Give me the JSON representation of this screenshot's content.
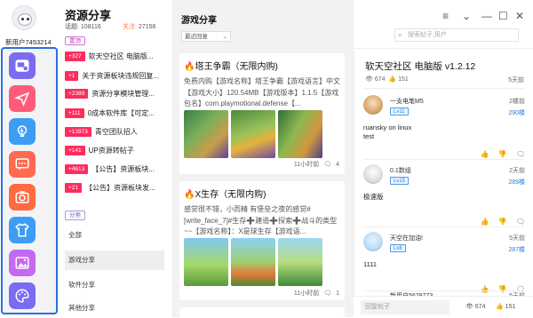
{
  "user": {
    "name": "新用户7453214"
  },
  "sidebar": {
    "colors": [
      "#7a6cf0",
      "#ff5c7a",
      "#3d9df5",
      "#ff6a50",
      "#ff6a40",
      "#3d9df5",
      "#c46af0",
      "#7a6cf0"
    ],
    "icons": [
      "community-icon",
      "send-icon",
      "bulb-icon",
      "chat-icon",
      "camera-icon",
      "shirt-icon",
      "image-icon",
      "palette-icon"
    ]
  },
  "forum": {
    "title": "资源分享",
    "posts_label": "话题:",
    "posts": "108116",
    "follow_label": "关注:",
    "follows": "27156",
    "hot_label": "置顶",
    "hot": [
      {
        "count": "+327",
        "title": "软天空社区 电脑版..."
      },
      {
        "count": "+1",
        "title": "关于资源板块违规回复..."
      },
      {
        "count": "+2389",
        "title": "资源分享模块管理..."
      },
      {
        "count": "+111",
        "title": "0成本软件库【可定..."
      },
      {
        "count": "+13973",
        "title": "青空团队招人"
      },
      {
        "count": "+141",
        "title": "UP资源转帖子"
      },
      {
        "count": "+4613",
        "title": "【公告】资源板块..."
      },
      {
        "count": "+21",
        "title": "【公告】资源板块发..."
      }
    ],
    "cat_label": "分类",
    "categories": [
      "全部",
      "游戏分享",
      "软件分享",
      "其他分享"
    ]
  },
  "feed": {
    "title": "游戏分享",
    "sort": "最近回复",
    "cards": [
      {
        "title": "塔王争霸（无限内购)",
        "desc": "免费内购【游戏名称】塔王争霸【游戏语言】中文【游戏大小】120.54MB【游戏版本】1.1.5【游戏包名】com.playmotional.defense【...",
        "time": "11小时前",
        "comments": "4"
      },
      {
        "title": "X生存（无限内购)",
        "desc": "感觉很不错，小而精 有堡垒之夜的感觉#[write_face_7]#生存➕建造➕探索➕战斗的类型~~【游戏名称】：X是球生存【游戏语...",
        "time": "11小时前",
        "comments": "1"
      }
    ]
  },
  "window": {
    "controls": [
      "≡",
      "⌄",
      "—",
      "☐",
      "✕"
    ]
  },
  "search": {
    "placeholder": "搜索帖子,用户"
  },
  "post": {
    "title": "软天空社区 电脑版 v1.2.12",
    "views": "674",
    "likes": "151",
    "time": "5天前"
  },
  "replies": [
    {
      "name": "一支电笔M5",
      "level": "Lv11",
      "floor": "2楼前",
      "fans": "290楼",
      "text": "ruansky on linux\ntest"
    },
    {
      "name": "0.1数组",
      "level": "Lv15",
      "floor": "2天前",
      "fans": "289楼",
      "text": "极速版"
    },
    {
      "name": "天空在加油!",
      "level": "Lv8",
      "floor": "5天前",
      "fans": "287楼",
      "text": "1111"
    },
    {
      "name": "新用户5629773",
      "level": "",
      "floor": "5天前",
      "fans": "",
      "text": ""
    }
  ],
  "reply_box": {
    "placeholder": "回复帖子",
    "views": "674",
    "likes": "151"
  }
}
